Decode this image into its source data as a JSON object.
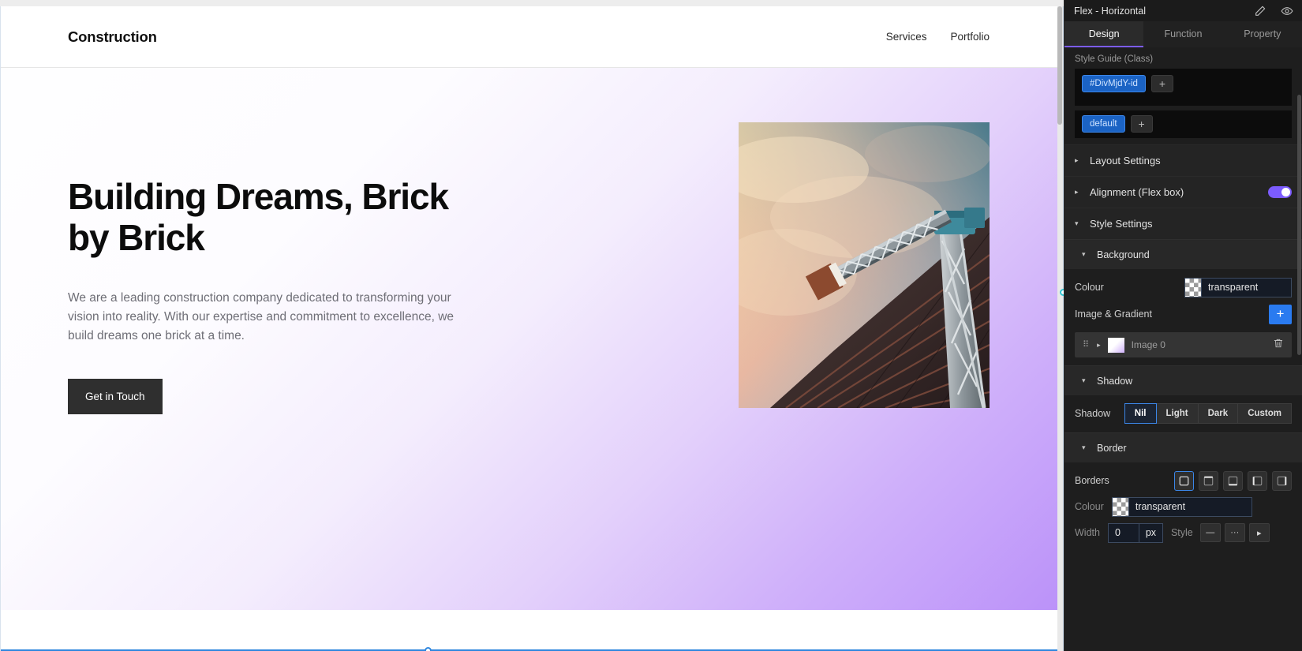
{
  "canvas": {
    "site": {
      "brand": "Construction",
      "nav": [
        {
          "label": "Services"
        },
        {
          "label": "Portfolio"
        }
      ],
      "hero": {
        "title": "Building Dreams, Brick by Brick",
        "subtitle": "We are a leading construction company dedicated to transforming your vision into reality. With our expertise and commitment to excellence, we build dreams one brick at a time.",
        "cta": "Get in Touch",
        "image_alt": "construction-crane-photo"
      }
    }
  },
  "panel": {
    "header": {
      "title": "Flex - Horizontal",
      "icons": [
        {
          "name": "pencil-icon"
        },
        {
          "name": "eye-icon"
        }
      ]
    },
    "tabs": [
      {
        "label": "Design",
        "active": true
      },
      {
        "label": "Function",
        "active": false
      },
      {
        "label": "Property",
        "active": false
      }
    ],
    "style_guide": {
      "label": "Style Guide (Class)",
      "id_chip": "#DivMjdY-id",
      "id_add": "+",
      "state_chip": "default",
      "state_add": "+"
    },
    "accordions": [
      {
        "label": "Layout Settings",
        "expanded": false,
        "caret": "▸"
      },
      {
        "label": "Alignment (Flex box)",
        "expanded": false,
        "caret": "▸",
        "toggle": true
      },
      {
        "label": "Style Settings",
        "expanded": true,
        "caret": "▾"
      }
    ],
    "background": {
      "label": "Background",
      "caret": "▾",
      "colour_label": "Colour",
      "colour_value": "transparent",
      "image_gradient_label": "Image & Gradient",
      "add_label": "+",
      "layers": [
        {
          "name": "Image 0",
          "caret": "▸"
        }
      ]
    },
    "shadow": {
      "label": "Shadow",
      "caret": "▾",
      "field_label": "Shadow",
      "options": [
        {
          "label": "Nil",
          "active": true
        },
        {
          "label": "Light",
          "active": false
        },
        {
          "label": "Dark",
          "active": false
        },
        {
          "label": "Custom",
          "active": false
        }
      ]
    },
    "border": {
      "label": "Border",
      "caret": "▾",
      "borders_label": "Borders",
      "sides": [
        {
          "name": "border-all-icon",
          "active": true
        },
        {
          "name": "border-top-icon",
          "active": false
        },
        {
          "name": "border-bottom-icon",
          "active": false
        },
        {
          "name": "border-left-icon",
          "active": false
        },
        {
          "name": "border-right-icon",
          "active": false
        }
      ],
      "colour_label": "Colour",
      "colour_value": "transparent",
      "width_label": "Width",
      "width_value": "0",
      "width_unit": "px",
      "style_label": "Style",
      "style_options": [
        {
          "name": "solid-line-icon",
          "glyph": "—"
        },
        {
          "name": "dashed-line-icon",
          "glyph": "···"
        },
        {
          "name": "more-arrow-icon",
          "glyph": "▸"
        }
      ]
    },
    "colors": {
      "accent_blue": "#2a7bf0",
      "accent_purple": "#7c5cff",
      "selection_blue": "#2f87de",
      "panel_bg": "#1e1e1e"
    }
  }
}
